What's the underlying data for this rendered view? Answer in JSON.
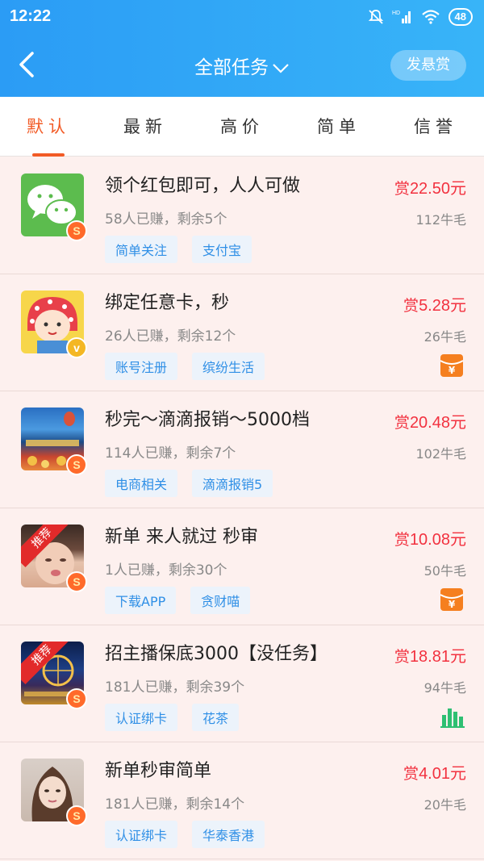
{
  "status": {
    "time": "12:22",
    "battery": "48",
    "network": "HD"
  },
  "header": {
    "title": "全部任务",
    "reward_button": "发悬赏"
  },
  "tabs": [
    "默认",
    "最新",
    "高价",
    "简单",
    "信誉"
  ],
  "active_tab": "默认",
  "tasks": [
    {
      "title": "领个红包即可，人人可做",
      "meta": "58人已赚，剩余5个",
      "tags": [
        "简单关注",
        "支付宝"
      ],
      "price_prefix": "赏",
      "price": "22.50元",
      "wool": "112牛毛",
      "badge": "S",
      "ribbon": ""
    },
    {
      "title": "绑定任意卡，秒",
      "meta": "26人已赚，剩余12个",
      "tags": [
        "账号注册",
        "缤纷生活"
      ],
      "price_prefix": "赏",
      "price": "5.28元",
      "wool": "26牛毛",
      "badge": "v",
      "ribbon": "",
      "flag_symbol": "¥"
    },
    {
      "title": "秒完～滴滴报销～5000档",
      "meta": "114人已赚，剩余7个",
      "tags": [
        "电商相关",
        "滴滴报销5"
      ],
      "price_prefix": "赏",
      "price": "20.48元",
      "wool": "102牛毛",
      "badge": "S",
      "ribbon": ""
    },
    {
      "title": "新单 来人就过 秒审",
      "meta": "1人已赚，剩余30个",
      "tags": [
        "下载APP",
        "贪财喵"
      ],
      "price_prefix": "赏",
      "price": "10.08元",
      "wool": "50牛毛",
      "badge": "S",
      "ribbon": "推荐",
      "flag_symbol": "¥"
    },
    {
      "title": "招主播保底3000【没任务】",
      "meta": "181人已赚，剩余39个",
      "tags": [
        "认证绑卡",
        "花茶"
      ],
      "price_prefix": "赏",
      "price": "18.81元",
      "wool": "94牛毛",
      "badge": "S",
      "ribbon": "推荐"
    },
    {
      "title": "新单秒审简单",
      "meta": "181人已赚，剩余14个",
      "tags": [
        "认证绑卡",
        "华泰香港"
      ],
      "price_prefix": "赏",
      "price": "4.01元",
      "wool": "20牛毛",
      "badge": "S",
      "ribbon": ""
    }
  ],
  "colors": {
    "header_start": "#2b9cf5",
    "header_end": "#38b4f8",
    "accent": "#f25b26",
    "price": "#f2313f",
    "tag_text": "#2f8fe6",
    "row_bg": "#fdf0ee"
  },
  "icons": {
    "back": "chevron-left-icon",
    "title_dropdown": "chevron-down-icon",
    "red_packet": "red-packet-icon",
    "stats": "bar-chart-icon"
  }
}
